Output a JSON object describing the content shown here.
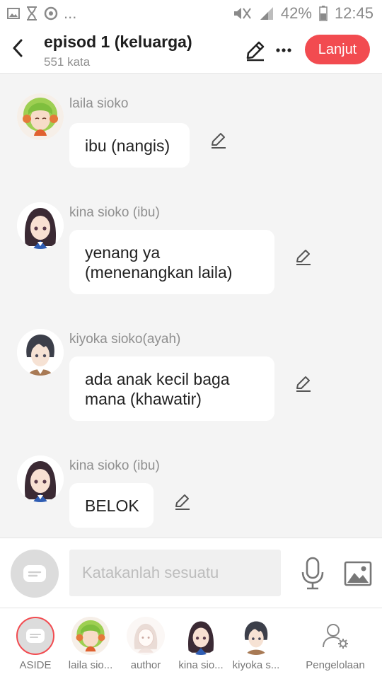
{
  "status_bar": {
    "battery": "42%",
    "time": "12:45",
    "ellipsis": "..."
  },
  "header": {
    "title": "episod 1 (keluarga)",
    "subtitle": "551 kata",
    "next_label": "Lanjut",
    "accent_color": "#f24b50"
  },
  "messages": [
    {
      "sender": "laila sioko",
      "text": "ibu (nangis)",
      "avatar": "green-hair-girl-avatar"
    },
    {
      "sender": "kina sioko (ibu)",
      "text": "yenang ya (menenangkan laila)",
      "avatar": "dark-hair-woman-avatar"
    },
    {
      "sender": "kiyoka sioko(ayah)",
      "text": "ada anak kecil baga mana (khawatir)",
      "avatar": "dark-hair-man-avatar"
    },
    {
      "sender": "kina sioko (ibu)",
      "text": "BELOK",
      "avatar": "dark-hair-woman-avatar"
    }
  ],
  "composer": {
    "placeholder": "Katakanlah sesuatu"
  },
  "tabs": [
    {
      "label": "ASIDE"
    },
    {
      "label": "laila sio..."
    },
    {
      "label": "author"
    },
    {
      "label": "kina sio..."
    },
    {
      "label": "kiyoka s..."
    },
    {
      "label": "Pengelolaan"
    }
  ]
}
